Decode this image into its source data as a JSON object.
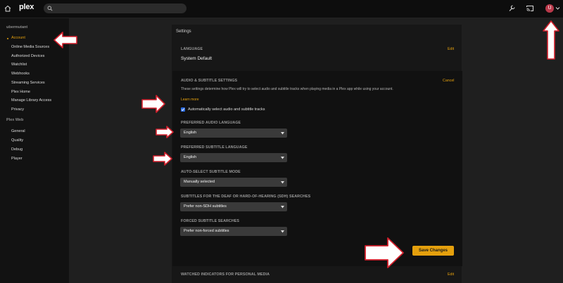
{
  "app": {
    "logo": "plex",
    "search": {
      "value": "",
      "placeholder": ""
    },
    "avatar_initial": "U"
  },
  "sidebar": {
    "user_section": "ubermutant",
    "user_items": [
      "Account",
      "Online Media Sources",
      "Authorized Devices",
      "Watchlist",
      "Webhooks",
      "Streaming Services",
      "Plex Home",
      "Manage Library Access",
      "Privacy"
    ],
    "web_section": "Plex Web",
    "web_items": [
      "General",
      "Quality",
      "Debug",
      "Player"
    ]
  },
  "main": {
    "title": "Settings",
    "language": {
      "heading": "LANGUAGE",
      "value": "System Default",
      "edit": "Edit"
    },
    "audio_subtitle": {
      "heading": "AUDIO & SUBTITLE SETTINGS",
      "cancel": "Cancel",
      "description": "These settings determine how Plex will try to select audio and subtitle tracks when playing media in a Plex app while using your account.",
      "learn_more": "Learn more",
      "auto_select_label": "Automatically select audio and subtitle tracks",
      "auto_select_checked": true,
      "fields": [
        {
          "label": "PREFERRED AUDIO LANGUAGE",
          "value": "English"
        },
        {
          "label": "PREFERRED SUBTITLE LANGUAGE",
          "value": "English"
        },
        {
          "label": "AUTO-SELECT SUBTITLE MODE",
          "value": "Manually selected"
        },
        {
          "label": "SUBTITLES FOR THE DEAF OR HARD-OF-HEARING (SDH) SEARCHES",
          "value": "Prefer non-SDH subtitles"
        },
        {
          "label": "FORCED SUBTITLE SEARCHES",
          "value": "Prefer non-forced subtitles"
        }
      ],
      "save": "Save Changes"
    },
    "watched": {
      "heading": "WATCHED INDICATORS FOR PERSONAL MEDIA",
      "edit": "Edit"
    }
  },
  "colors": {
    "accent": "#e5a00d",
    "avatar": "#b9394a",
    "checkbox": "#2d6cdf",
    "arrow_fill": "#ffffff",
    "arrow_stroke": "#d21f2b"
  }
}
